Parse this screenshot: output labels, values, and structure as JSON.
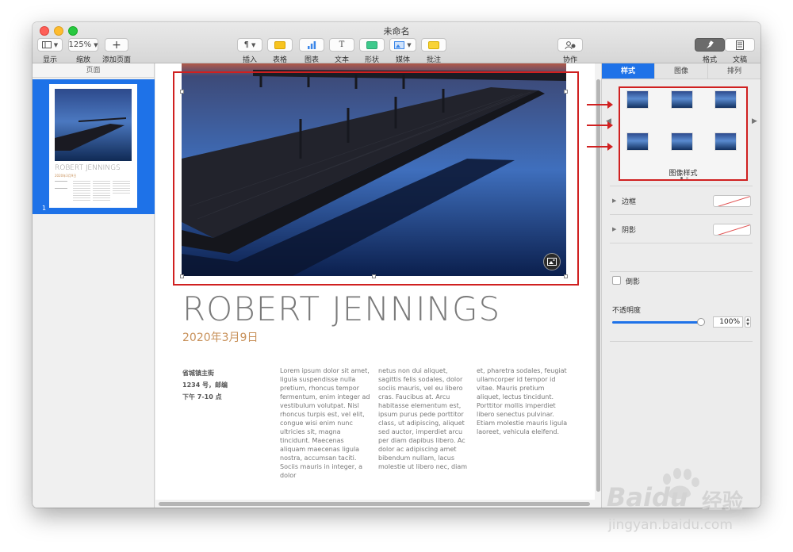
{
  "window": {
    "title": "未命名"
  },
  "toolbar": {
    "view": {
      "label": "显示"
    },
    "zoom": {
      "value": "125%",
      "label": "缩放"
    },
    "add_page": {
      "label": "添加页面"
    },
    "insert": {
      "label": "插入"
    },
    "table": {
      "label": "表格"
    },
    "chart": {
      "label": "图表"
    },
    "text": {
      "label": "文本"
    },
    "shape": {
      "label": "形状"
    },
    "media": {
      "label": "媒体"
    },
    "comment": {
      "label": "批注"
    },
    "collaborate": {
      "label": "协作"
    },
    "format": {
      "label": "格式"
    },
    "document": {
      "label": "文稿"
    }
  },
  "pages_panel": {
    "header": "页面",
    "thumbnails": [
      {
        "number": "1",
        "name": "ROBERT JENNINGS",
        "date": "2020年3月9日"
      }
    ]
  },
  "document": {
    "name": "ROBERT JENNINGS",
    "date": "2020年3月9日",
    "address": [
      "省城镇主街",
      "1234 号，邮编",
      "下午 7-10 点"
    ],
    "columns": [
      "Lorem ipsum dolor sit amet, ligula suspendisse nulla pretium, rhoncus tempor fermentum, enim integer ad vestibulum volutpat. Nisl rhoncus turpis est, vel elit, congue wisi enim nunc ultricies sit, magna tincidunt. Maecenas aliquam maecenas ligula nostra, accumsan taciti. Sociis mauris in integer, a dolor",
      "netus non dui aliquet, sagittis felis sodales, dolor sociis mauris, vel eu libero cras. Faucibus at. Arcu habitasse elementum est, ipsum purus pede porttitor class, ut adipiscing, aliquet sed auctor, imperdiet arcu per diam dapibus libero. Ac dolor ac adipiscing amet bibendum nullam, lacus molestie ut libero nec, diam",
      "et, pharetra sodales, feugiat ullamcorper id tempor id vitae. Mauris pretium aliquet, lectus tincidunt. Porttitor mollis imperdiet libero senectus pulvinar. Etiam molestie mauris ligula laoreet, vehicula eleifend."
    ]
  },
  "inspector": {
    "tabs": [
      {
        "label": "样式",
        "active": true
      },
      {
        "label": "图像",
        "active": false
      },
      {
        "label": "排列",
        "active": false
      }
    ],
    "styles_caption": "图像样式",
    "border_label": "边框",
    "shadow_label": "阴影",
    "reflection_label": "倒影",
    "opacity_label": "不透明度",
    "opacity_value": "100%",
    "opacity_level": 1.0
  },
  "watermark": {
    "brand": "Baidu",
    "sub": "经验",
    "url": "jingyan.baidu.com"
  },
  "colors": {
    "accent": "#1e72e8",
    "annotation": "#d02020",
    "date": "#c8915a"
  }
}
